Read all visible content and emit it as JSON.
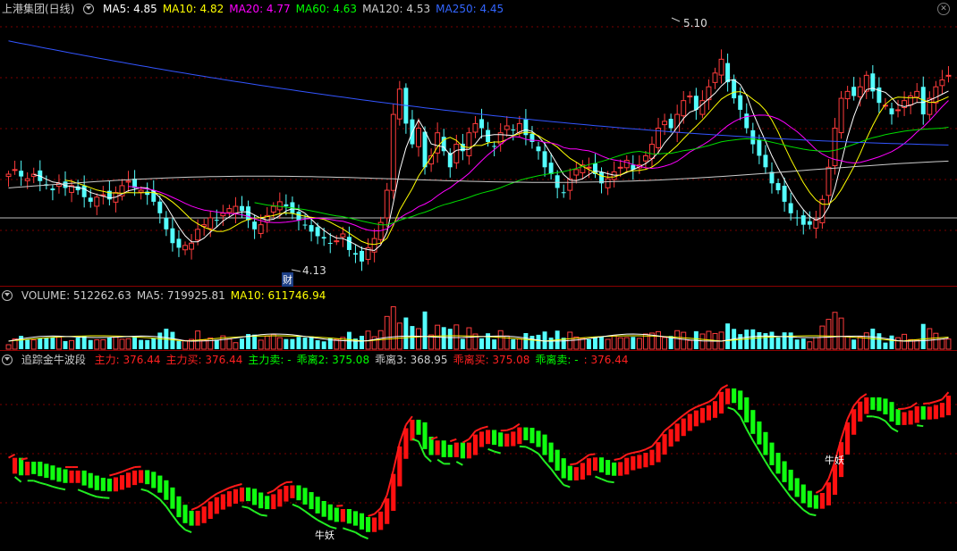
{
  "price_panel": {
    "title": "上港集团(日线)",
    "ma_items": [
      {
        "label": "MA5: 4.85",
        "color": "#ffffff"
      },
      {
        "label": "MA10: 4.82",
        "color": "#ffff00"
      },
      {
        "label": "MA20: 4.77",
        "color": "#ff00ff"
      },
      {
        "label": "MA60: 4.63",
        "color": "#00ff00"
      },
      {
        "label": "MA120: 4.53",
        "color": "#cccccc"
      },
      {
        "label": "MA250: 4.45",
        "color": "#3366ff"
      }
    ],
    "high_label": "5.10",
    "low_label": "4.13",
    "event_label": "财"
  },
  "volume_panel": {
    "items": [
      {
        "label": "VOLUME: 512262.63",
        "color": "#cccccc"
      },
      {
        "label": "MA5: 719925.81",
        "color": "#cccccc"
      },
      {
        "label": "MA10: 611746.94",
        "color": "#ffff00"
      }
    ]
  },
  "indicator_panel": {
    "title": "追踪金牛波段",
    "items": [
      {
        "label": "主力: 376.44",
        "color": "#ff2020"
      },
      {
        "label": "主力买: 376.44",
        "color": "#ff2020"
      },
      {
        "label": "主力卖: -",
        "color": "#00ff00"
      },
      {
        "label": "乖离2: 375.08",
        "color": "#00ff00"
      },
      {
        "label": "乖离3: 368.95",
        "color": "#cccccc"
      },
      {
        "label": "乖离买: 375.08",
        "color": "#ff2020"
      },
      {
        "label": "乖离卖: -",
        "color": "#00ff00"
      },
      {
        "label": ": 376.44",
        "color": "#ff2020"
      }
    ],
    "signal_label": "牛妖"
  },
  "chart_data": {
    "type": "candlestick",
    "price_range": [
      4.13,
      5.1
    ],
    "series": [
      {
        "name": "MA5",
        "values": [
          4.85
        ]
      },
      {
        "name": "MA10",
        "values": [
          4.82
        ]
      },
      {
        "name": "MA20",
        "values": [
          4.77
        ]
      },
      {
        "name": "MA60",
        "values": [
          4.63
        ]
      },
      {
        "name": "MA120",
        "values": [
          4.53
        ]
      },
      {
        "name": "MA250",
        "values": [
          4.45
        ]
      }
    ],
    "close": [
      4.52,
      4.54,
      4.51,
      4.5,
      4.52,
      4.49,
      4.47,
      4.45,
      4.48,
      4.46,
      4.47,
      4.45,
      4.42,
      4.4,
      4.42,
      4.43,
      4.41,
      4.44,
      4.47,
      4.49,
      4.46,
      4.45,
      4.43,
      4.4,
      4.35,
      4.28,
      4.22,
      4.2,
      4.21,
      4.22,
      4.28,
      4.3,
      4.33,
      4.32,
      4.35,
      4.37,
      4.38,
      4.36,
      4.32,
      4.28,
      4.3,
      4.34,
      4.38,
      4.4,
      4.38,
      4.35,
      4.32,
      4.3,
      4.27,
      4.25,
      4.24,
      4.22,
      4.23,
      4.26,
      4.19,
      4.17,
      4.14,
      4.2,
      4.24,
      4.31,
      4.45,
      4.78,
      4.89,
      4.74,
      4.65,
      4.72,
      4.55,
      4.6,
      4.7,
      4.62,
      4.55,
      4.65,
      4.62,
      4.7,
      4.74,
      4.72,
      4.66,
      4.64,
      4.7,
      4.73,
      4.71,
      4.74,
      4.69,
      4.66,
      4.62,
      4.55,
      4.52,
      4.46,
      4.44,
      4.5,
      4.54,
      4.56,
      4.55,
      4.52,
      4.48,
      4.5,
      4.53,
      4.55,
      4.58,
      4.54,
      4.56,
      4.6,
      4.65,
      4.72,
      4.75,
      4.72,
      4.78,
      4.84,
      4.86,
      4.8,
      4.84,
      4.9,
      4.96,
      5.02,
      4.92,
      4.85,
      4.8,
      4.72,
      4.65,
      4.6,
      4.55,
      4.48,
      4.45,
      4.4,
      4.35,
      4.33,
      4.3,
      4.3,
      4.32,
      4.41,
      4.55,
      4.72,
      4.85,
      4.88,
      4.86,
      4.9,
      4.95,
      4.88,
      4.83,
      4.82,
      4.78,
      4.8,
      4.84,
      4.86,
      4.88,
      4.78,
      4.85,
      4.9,
      4.93,
      4.95
    ],
    "volume_ma5": 719925.81,
    "volume_ma10": 611746.94,
    "volume_last": 512262.63
  }
}
